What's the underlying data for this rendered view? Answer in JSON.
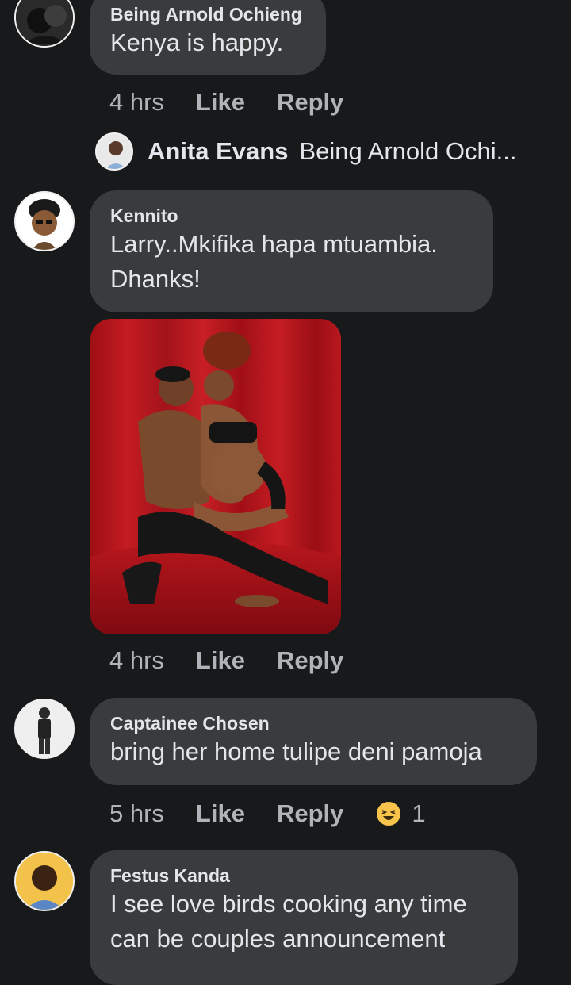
{
  "comments": [
    {
      "author": "Being Arnold Ochieng",
      "text": "Kenya is happy.",
      "time": "4 hrs",
      "like": "Like",
      "reply": "Reply",
      "reply_preview": {
        "author": "Anita Evans",
        "text": "Being Arnold Ochi..."
      }
    },
    {
      "author": "Kennito",
      "text_line1": "Larry..Mkifika hapa mtuambia.",
      "text_line2": "Dhanks!",
      "time": "4 hrs",
      "like": "Like",
      "reply": "Reply"
    },
    {
      "author": "Captainee Chosen",
      "text": "bring her home tulipe deni pamoja",
      "time": "5 hrs",
      "like": "Like",
      "reply": "Reply",
      "reaction_count": "1",
      "reaction_icon": "laughing-emoji-icon"
    },
    {
      "author": "Festus Kanda",
      "text_line1": "I see love birds cooking any time",
      "text_line2": "can be couples announcement"
    }
  ],
  "colors": {
    "background": "#18191a",
    "bubble": "#3a3b3c",
    "text": "#e4e6eb",
    "meta": "#b0b3b8",
    "photo_backdrop": "#b31218"
  }
}
